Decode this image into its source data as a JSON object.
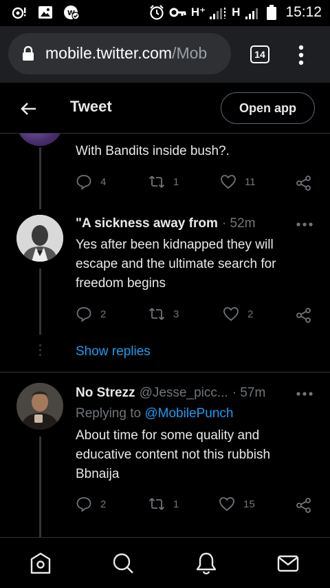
{
  "status_bar": {
    "network_1": "H⁺",
    "network_2": "H",
    "time": "15:12",
    "icons": [
      "notification-icon",
      "gallery-icon",
      "vpn-shield-icon",
      "alarm-icon",
      "key-icon",
      "signal-icon",
      "battery-icon"
    ]
  },
  "browser": {
    "url_host": "mobile.twitter.com",
    "url_path": "/Mob",
    "tab_count": "14"
  },
  "header": {
    "title": "Tweet",
    "open_app_label": "Open app"
  },
  "tweets": [
    {
      "text": "With Bandits inside bush?.",
      "replies": "4",
      "retweets": "1",
      "likes": "11"
    },
    {
      "name": "\"A sickness away from",
      "time": "· 52m",
      "text": "Yes after been kidnapped they will escape and the ultimate search for freedom begins",
      "replies": "2",
      "retweets": "3",
      "likes": "2",
      "show_replies": "Show replies"
    },
    {
      "name": "No Strezz",
      "handle": "@Jesse_picc...",
      "time": "· 57m",
      "replying_prefix": "Replying to",
      "replying_to": "@MobilePunch",
      "text": "About time for some quality and educative content not this rubbish Bbnaija",
      "replies": "2",
      "retweets": "1",
      "likes": "15"
    }
  ],
  "bottom_nav": [
    "home-icon",
    "search-icon",
    "notifications-icon",
    "messages-icon"
  ],
  "colors": {
    "background": "#000000",
    "accent": "#1d9bf0",
    "muted": "#71767b",
    "divider": "#2f3336"
  }
}
